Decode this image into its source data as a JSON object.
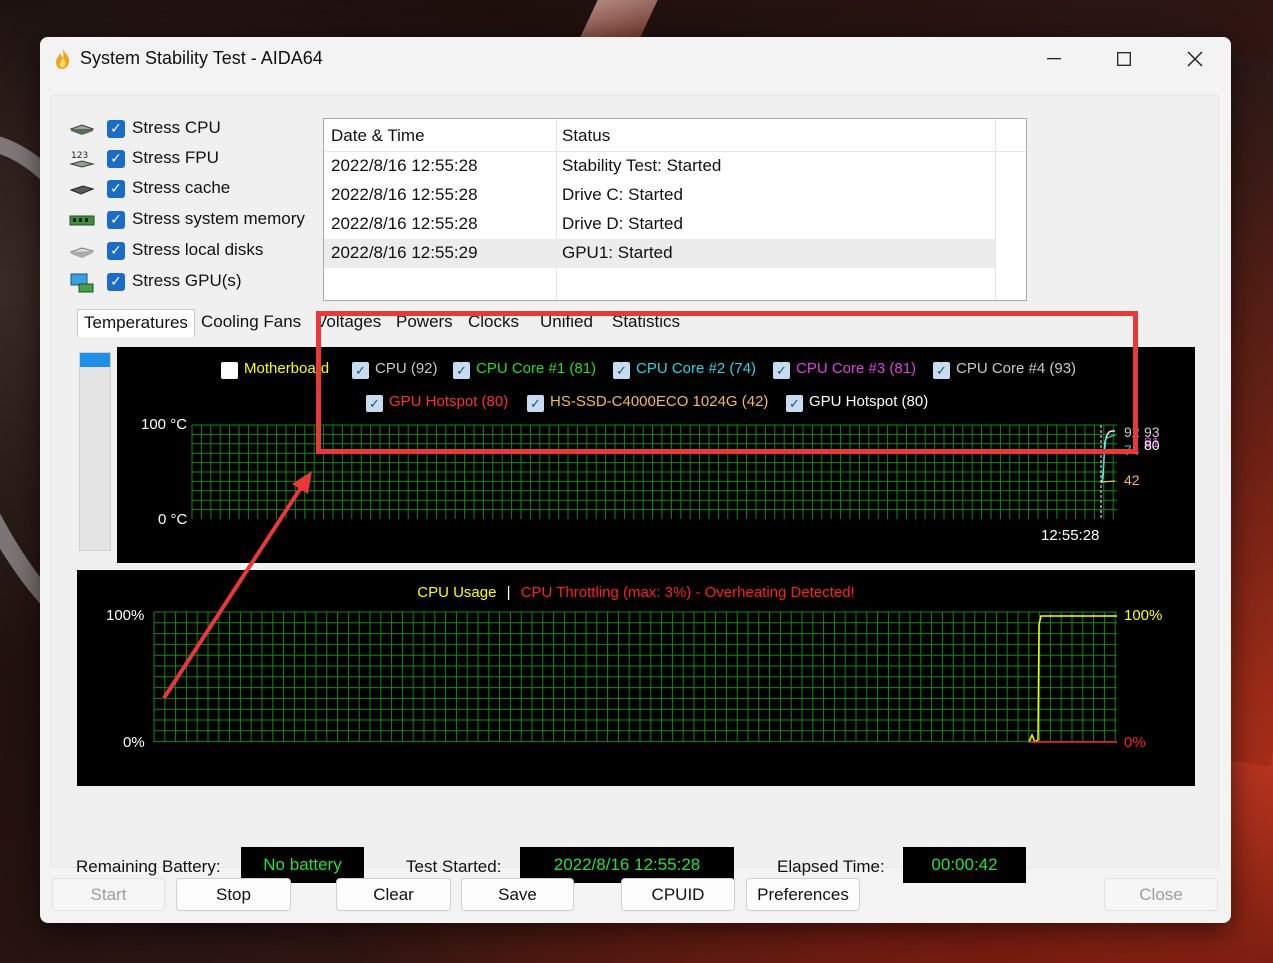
{
  "window": {
    "title": "System Stability Test - AIDA64"
  },
  "stress": [
    {
      "label": "Stress CPU",
      "icon": "cpu-chip-icon",
      "checked": true
    },
    {
      "label": "Stress FPU",
      "icon": "fpu-123-icon",
      "checked": true
    },
    {
      "label": "Stress cache",
      "icon": "cache-chip-icon",
      "checked": true
    },
    {
      "label": "Stress system memory",
      "icon": "memory-module-icon",
      "checked": true
    },
    {
      "label": "Stress local disks",
      "icon": "disk-drive-icon",
      "checked": true
    },
    {
      "label": "Stress GPU(s)",
      "icon": "gpu-monitor-icon",
      "checked": true
    }
  ],
  "log": {
    "headers": [
      "Date & Time",
      "Status"
    ],
    "rows": [
      {
        "time": "2022/8/16 12:55:28",
        "status": "Stability Test: Started"
      },
      {
        "time": "2022/8/16 12:55:28",
        "status": "Drive C: Started"
      },
      {
        "time": "2022/8/16 12:55:28",
        "status": "Drive D: Started"
      },
      {
        "time": "2022/8/16 12:55:29",
        "status": "GPU1: Started"
      }
    ]
  },
  "tabs": [
    "Temperatures",
    "Cooling Fans",
    "Voltages",
    "Powers",
    "Clocks",
    "Unified",
    "Statistics"
  ],
  "temp_legend": [
    {
      "label": "Motherboard",
      "color": "#ffff00",
      "checked": false
    },
    {
      "label": "CPU (92)",
      "color": "#c8c8c8",
      "checked": true
    },
    {
      "label": "CPU Core #1 (81)",
      "color": "#22dd22",
      "checked": true
    },
    {
      "label": "CPU Core #2 (74)",
      "color": "#22d8e8",
      "checked": true
    },
    {
      "label": "CPU Core #3 (81)",
      "color": "#e040e0",
      "checked": true
    },
    {
      "label": "CPU Core #4 (93)",
      "color": "#c8c8c8",
      "checked": true
    },
    {
      "label": "GPU Hotspot (80)",
      "color": "#ff3030",
      "checked": true
    },
    {
      "label": "HS-SSD-C4000ECO 1024G (42)",
      "color": "#f4b860",
      "checked": true
    },
    {
      "label": "GPU Hotspot (80)",
      "color": "#ffffff",
      "checked": true
    }
  ],
  "temp_axis": {
    "top": "100 °C",
    "bottom": "0 °C",
    "time": "12:55:28"
  },
  "temp_end_values": [
    "92",
    "93",
    "81",
    "80",
    "74",
    "42"
  ],
  "usage_title": {
    "usage": "CPU Usage",
    "sep": "|",
    "throttle": "CPU Throttling (max: 3%) - Overheating Detected!"
  },
  "usage_axis": {
    "left_top": "100%",
    "left_bottom": "0%",
    "right_top": "100%",
    "right_bottom": "0%"
  },
  "status": {
    "battery_label": "Remaining Battery:",
    "battery_value": "No battery",
    "started_label": "Test Started:",
    "started_value": "2022/8/16 12:55:28",
    "elapsed_label": "Elapsed Time:",
    "elapsed_value": "00:00:42"
  },
  "buttons": [
    "Start",
    "Stop",
    "Clear",
    "Save",
    "CPUID",
    "Preferences",
    "Close"
  ],
  "colors": {
    "grid": "#0f8a0f",
    "status_text": "#26e03a",
    "annotation": "#e8383a",
    "accent": "#1b6cc4"
  }
}
